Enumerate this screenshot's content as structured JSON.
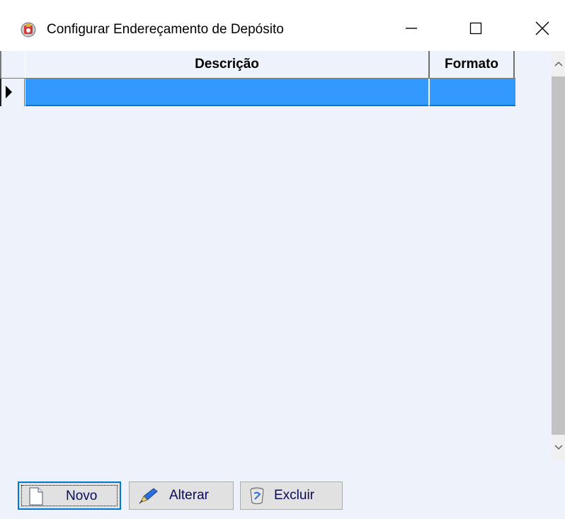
{
  "window": {
    "title": "Configurar Endereçamento de Depósito"
  },
  "grid": {
    "columns": [
      "Descrição",
      "Formato"
    ],
    "rows": [
      {
        "descricao": "",
        "formato": ""
      }
    ],
    "selected_color": "#3399ff"
  },
  "buttons": {
    "novo": "Novo",
    "alterar": "Alterar",
    "excluir": "Excluir"
  },
  "icons": {
    "app": "app-icon",
    "minimize": "minimize-icon",
    "maximize": "maximize-icon",
    "close": "close-icon",
    "row_indicator": "row-indicator-arrow-icon",
    "novo": "new-document-icon",
    "alterar": "pencil-icon",
    "excluir": "trash-icon"
  }
}
